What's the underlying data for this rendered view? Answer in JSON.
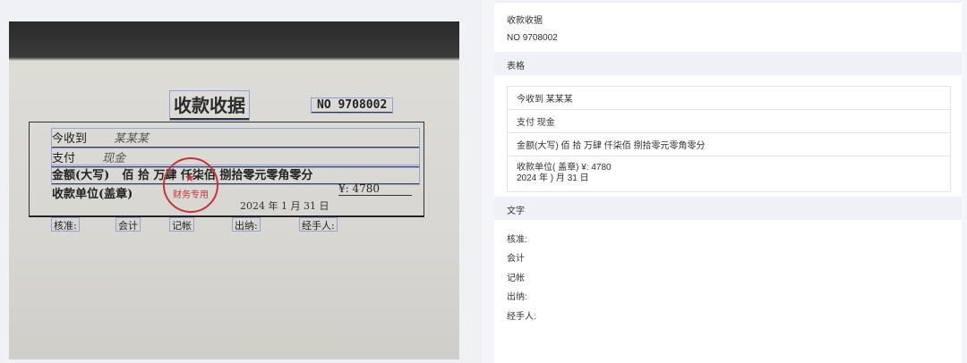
{
  "receipt_image": {
    "title": "收款收据",
    "no": "NO 9708002",
    "lines": [
      {
        "label": "今收到",
        "value": "某某某"
      },
      {
        "label": "支付",
        "value": "现金"
      },
      {
        "label": "金额(大写)",
        "value": "佰 拾 万肆 仟柒佰 捌拾零元零角零分"
      },
      {
        "label": "收款单位(盖章)",
        "value": ""
      }
    ],
    "stamp_text": "财务专用",
    "amount": "¥: 4780",
    "date": "2024 年 1 月 31 日",
    "footer": [
      "核准:",
      "会计",
      "记帐",
      "出纳:",
      "经手人:"
    ]
  },
  "panel": {
    "header_title": "收款收据",
    "header_no": "NO 9708002",
    "table_section": "表格",
    "table_rows": [
      "今收到 某某某",
      "支付 现金",
      "金额(大写) 佰 拾 万肆 仟柒佰 捌拾零元零角零分"
    ],
    "last_row_line1": "收款单位( 盖章) ¥: 4780",
    "last_row_line2": "2024 年 ) 月 31 日",
    "text_section": "文字",
    "text_lines": [
      "核准:",
      "会计",
      "记帐",
      "出纳:",
      "经手人:"
    ]
  }
}
